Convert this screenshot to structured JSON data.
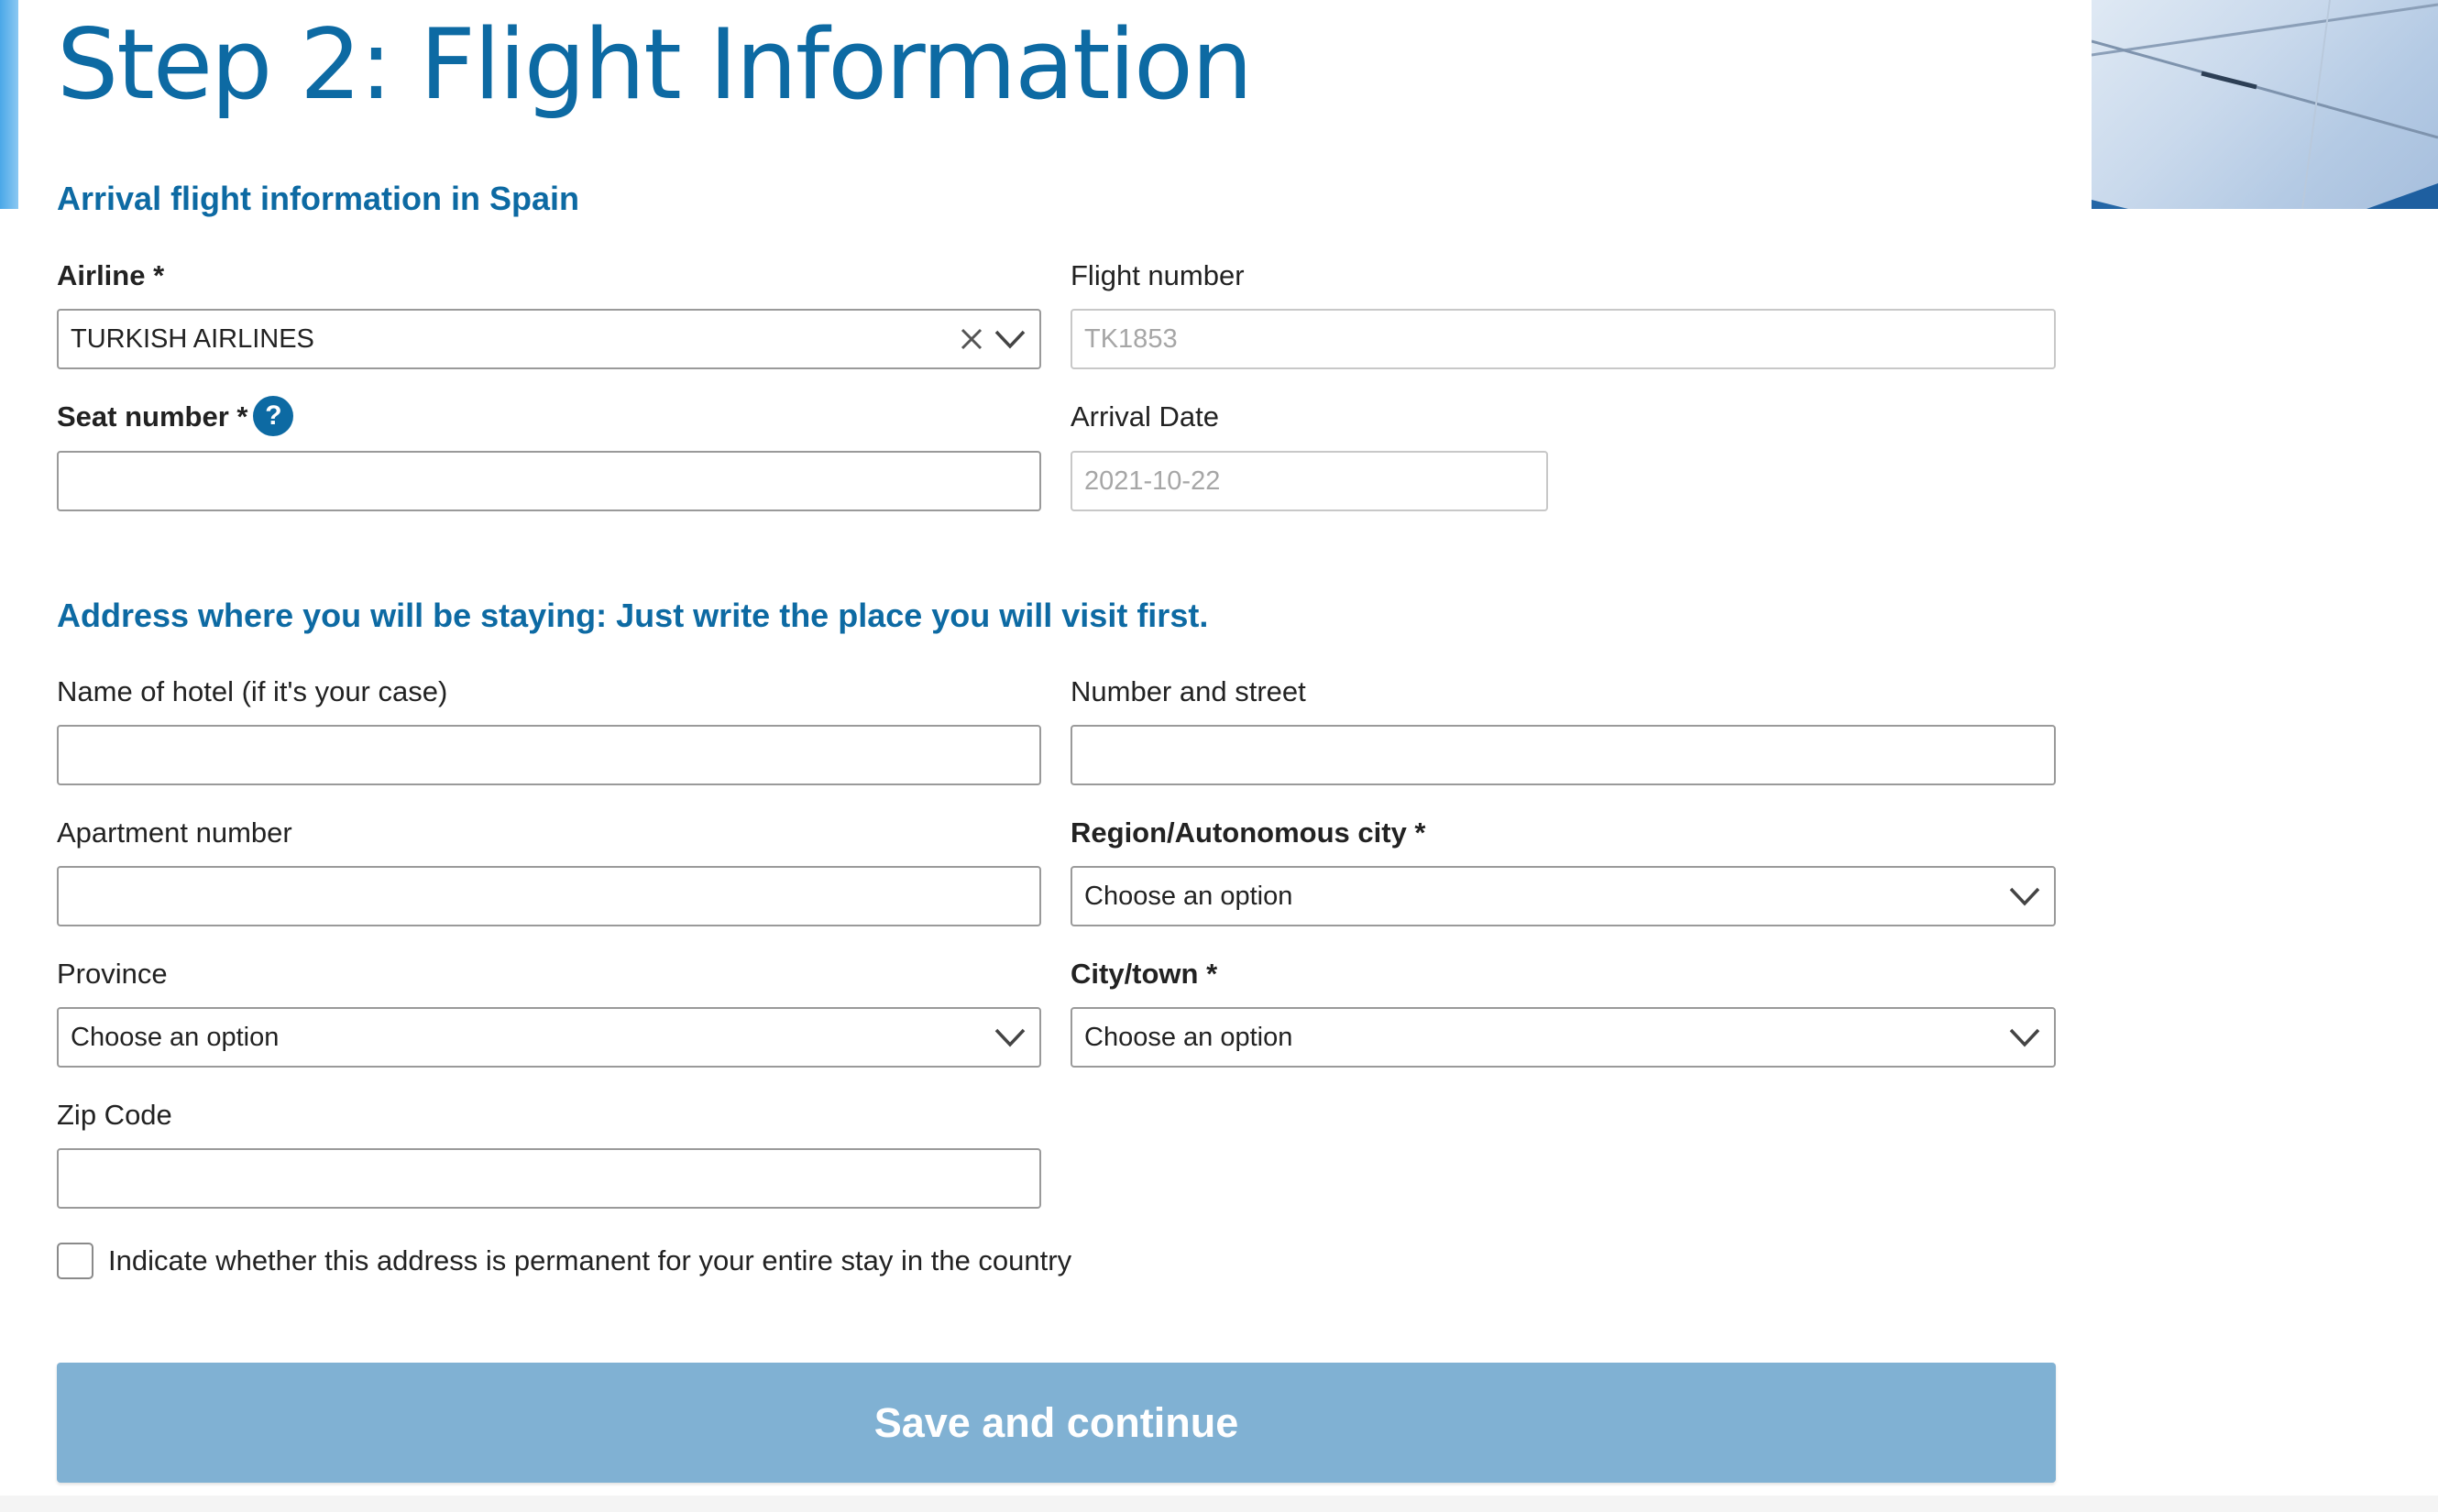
{
  "title": "Step 2: Flight Information",
  "flight_section": {
    "heading": "Arrival flight information in Spain",
    "airline": {
      "label": "Airline *",
      "value": "TURKISH AIRLINES",
      "icons": [
        "close-icon",
        "chevron-down-icon"
      ]
    },
    "flight_number": {
      "label": "Flight number",
      "value": "TK1853"
    },
    "seat_number": {
      "label": "Seat number *",
      "help": "?",
      "value": ""
    },
    "arrival_date": {
      "label": "Arrival Date",
      "value": "2021-10-22"
    }
  },
  "address_section": {
    "heading": "Address where you will be staying: Just write the place you will visit first.",
    "hotel_name": {
      "label": "Name of hotel (if it's your case)",
      "value": ""
    },
    "street": {
      "label": "Number and street",
      "value": ""
    },
    "apartment": {
      "label": "Apartment number",
      "value": ""
    },
    "region": {
      "label": "Region/Autonomous city *",
      "value": "Choose an option"
    },
    "province": {
      "label": "Province",
      "value": "Choose an option"
    },
    "city": {
      "label": "City/town *",
      "value": "Choose an option"
    },
    "zip": {
      "label": "Zip Code",
      "value": ""
    },
    "permanent": {
      "label": "Indicate whether this address is permanent for your entire stay in the country",
      "checked": false
    }
  },
  "submit": {
    "label": "Save and continue"
  },
  "colors": {
    "brand_blue": "#0d6aa3",
    "button_bg": "#80b1d3",
    "input_border": "#9a9a9a"
  }
}
